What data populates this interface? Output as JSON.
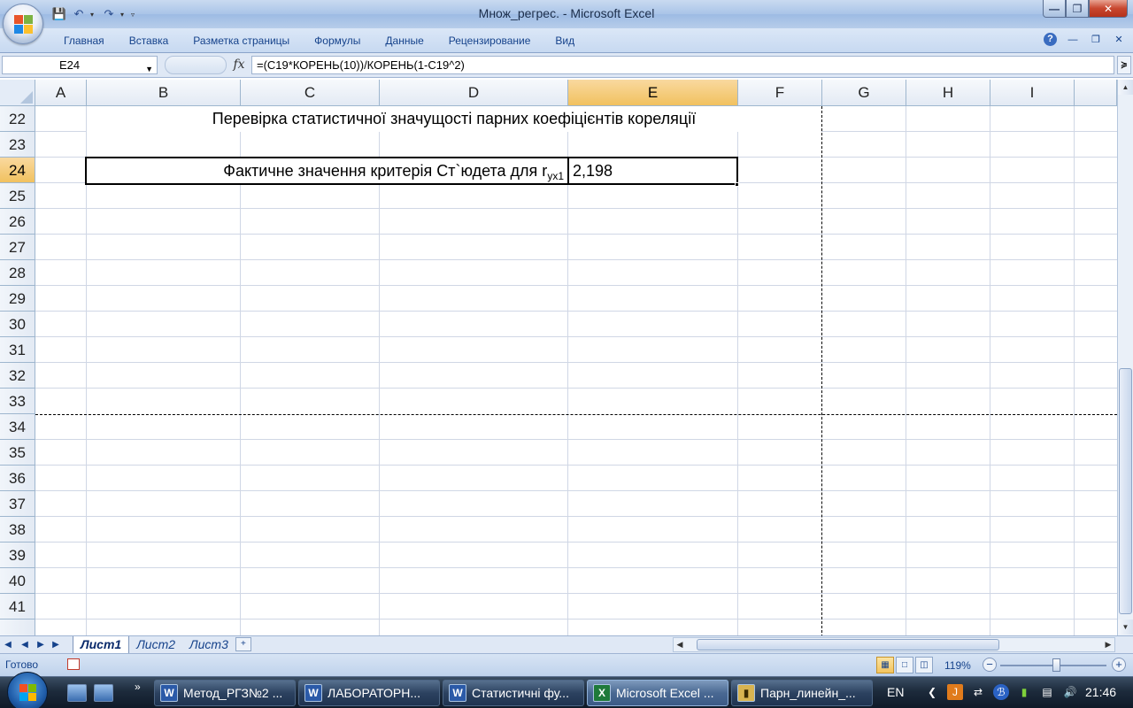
{
  "window": {
    "title": "Множ_регрес. - Microsoft Excel",
    "minimize": "—",
    "maximize": "❐",
    "close": "✕"
  },
  "qat": {
    "save_icon": "save-icon",
    "undo_icon": "undo-icon",
    "redo_icon": "redo-icon"
  },
  "ribbon": {
    "tabs": [
      "Главная",
      "Вставка",
      "Разметка страницы",
      "Формулы",
      "Данные",
      "Рецензирование",
      "Вид"
    ],
    "help": "?",
    "min": "—",
    "restore": "❐",
    "close": "✕"
  },
  "formula_bar": {
    "name_box": "E24",
    "fx": "fx",
    "formula": "=(C19*КОРЕНЬ(10))/КОРЕНЬ(1-C19^2)",
    "expand": "≽"
  },
  "columns": [
    "A",
    "B",
    "C",
    "D",
    "E",
    "F",
    "G",
    "H",
    "I"
  ],
  "selected_column": "E",
  "rows": [
    "22",
    "23",
    "24",
    "25",
    "26",
    "27",
    "28",
    "29",
    "30",
    "31",
    "32",
    "33",
    "34",
    "35",
    "36",
    "37",
    "38",
    "39",
    "40",
    "41"
  ],
  "selected_row": "24",
  "cells": {
    "title_text": "Перевірка статистичної значущості парних коефіцієнтів кореляції",
    "label_text": "Фактичне значення критерія Ст`юдета для r",
    "label_sub": "yx1",
    "value": "2,198"
  },
  "sheets": [
    "Лист1",
    "Лист2",
    "Лист3"
  ],
  "active_sheet": "Лист1",
  "status": {
    "ready": "Готово",
    "zoom": "119%",
    "zoom_value_percent": 119
  },
  "taskbar": {
    "items": [
      {
        "label": "Метод_РГЗ№2 ...",
        "icon": "word"
      },
      {
        "label": "ЛАБОРАТОРН...",
        "icon": "word"
      },
      {
        "label": "Статистичні фу...",
        "icon": "word"
      },
      {
        "label": "Microsoft Excel ...",
        "icon": "excel",
        "active": true
      },
      {
        "label": "Парн_линейн_...",
        "icon": "folder"
      }
    ],
    "lang": "EN",
    "time": "21:46"
  },
  "colors": {
    "selected_header": "#f1c15f",
    "gridline": "#d0d7e5",
    "ribbon_text": "#15428b"
  }
}
